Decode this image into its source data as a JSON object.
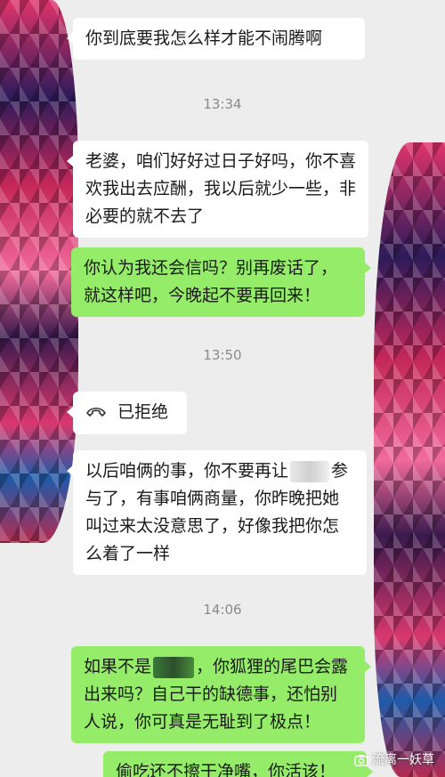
{
  "messages": {
    "m1": "你到底要我怎么样才能不闹腾啊",
    "t1": "13:34",
    "m2": "老婆，咱们好好过日子好吗，你不喜欢我出去应酬，我以后就少一些，非必要的就不去了",
    "m3": "你认为我还会信吗？别再废话了，就这样吧，今晚起不要再回来！",
    "t2": "13:50",
    "call_status": "已拒绝",
    "m4a": "以后咱俩的事，你不要再让",
    "m4b": "参与了，有事咱俩商量，你昨晚把她叫过来太没意思了，好像我把你怎么着了一样",
    "t3": "14:06",
    "m5a": "如果不是",
    "m5b": "，你狐狸的尾巴会露出来吗？自己干的缺德事，还怕别人说，你可真是无耻到了极点！",
    "m6": "偷吃还不擦干净嘴，你活该！"
  },
  "watermark": {
    "text": "流离一妖草"
  },
  "colors": {
    "received": "#ffffff",
    "sent": "#95ec69",
    "background": "#ededed"
  },
  "icons": {
    "call": "phone-hangup-icon",
    "watermark_logo": "camera-icon"
  }
}
